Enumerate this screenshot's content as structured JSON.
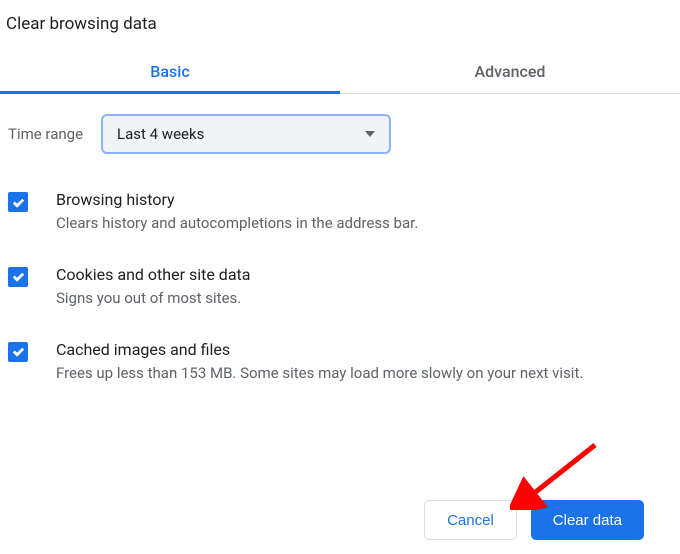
{
  "dialog": {
    "title": "Clear browsing data"
  },
  "tabs": {
    "basic": "Basic",
    "advanced": "Advanced"
  },
  "time_range": {
    "label": "Time range",
    "selected": "Last 4 weeks"
  },
  "options": [
    {
      "title": "Browsing history",
      "desc": "Clears history and autocompletions in the address bar."
    },
    {
      "title": "Cookies and other site data",
      "desc": "Signs you out of most sites."
    },
    {
      "title": "Cached images and files",
      "desc": "Frees up less than 153 MB. Some sites may load more slowly on your next visit."
    }
  ],
  "buttons": {
    "cancel": "Cancel",
    "clear": "Clear data"
  }
}
